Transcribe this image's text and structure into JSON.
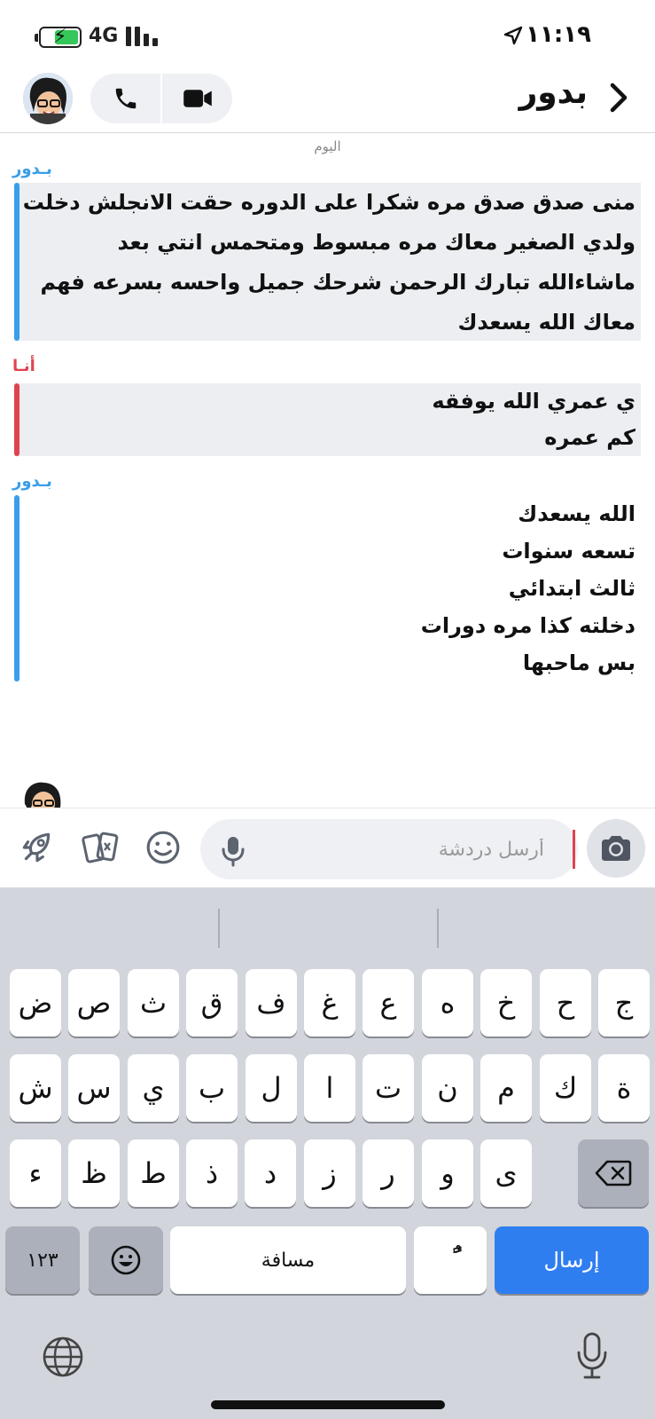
{
  "status_bar": {
    "time": "١١:١٩",
    "network": "4G",
    "battery_level": 0.6
  },
  "header": {
    "title": "بدور",
    "icons": [
      "chevron-right-icon",
      "phone-icon",
      "video-icon",
      "avatar"
    ]
  },
  "chat": {
    "day_label": "اليوم",
    "messages": [
      {
        "sender": "بـدور",
        "lines": [
          "منى صدق صدق مره شكرا على الدوره حقت الانجلش دخلت",
          "ولدي الصغير معاك مره مبسوط ومتحمس انتي بعد",
          "ماشاءالله تبارك الرحمن شرحك جميل واحسه بسرعه فهم",
          "معاك الله يسعدك"
        ]
      },
      {
        "sender": "أنـا",
        "lines": [
          "ي عمري  الله يوفقه",
          "كم عمره"
        ]
      },
      {
        "sender": "بـدور",
        "lines": [
          "الله يسعدك",
          "تسعه سنوات",
          "ثالث ابتدائي",
          "دخلته كذا مره دورات",
          "بس ماحبها"
        ]
      }
    ]
  },
  "composer": {
    "placeholder": "أرسل دردشة",
    "value": "",
    "icons": [
      "rocket-icon",
      "cards-icon",
      "smiley-icon",
      "mic-icon",
      "camera-icon"
    ]
  },
  "keyboard": {
    "row1": [
      "ج",
      "ح",
      "خ",
      "ه",
      "ع",
      "غ",
      "ف",
      "ق",
      "ث",
      "ص",
      "ض"
    ],
    "row2": [
      "ة",
      "ك",
      "م",
      "ن",
      "ت",
      "ا",
      "ل",
      "ب",
      "ي",
      "س",
      "ش"
    ],
    "row3": [
      "ى",
      "و",
      "ر",
      "ز",
      "د",
      "ذ",
      "ط",
      "ظ",
      "ء"
    ],
    "numbers_key": "١٢٣",
    "space_key": "مسافة",
    "diacritic_key": "ًٌ",
    "send_key": "إرسال",
    "colors": {
      "send": "#2f7ef0",
      "background": "#d2d5db"
    }
  },
  "colors": {
    "them": "#3a9ee8",
    "me": "#e0434f",
    "bubble": "#eceef1"
  }
}
